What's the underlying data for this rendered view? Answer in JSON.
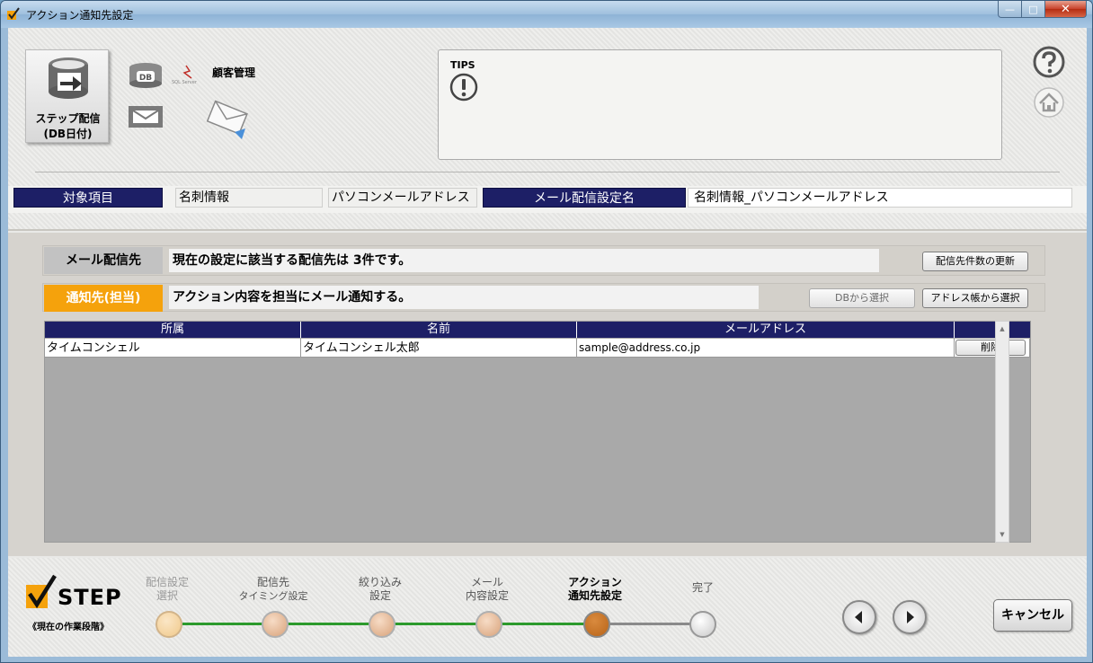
{
  "window": {
    "title": "アクション通知先設定",
    "buttons": {
      "minimize": "—",
      "maximize": "□",
      "close": "✕"
    }
  },
  "header": {
    "step_tile_line1": "ステップ配信",
    "step_tile_line2": "(DB日付)",
    "db_label": "DB",
    "sql_label": "SQL Server",
    "customer_mgmt": "顧客管理",
    "tips_label": "TIPS",
    "tips_icon": "exclamation-icon",
    "help_icon": "question-icon",
    "home_icon": "home-icon"
  },
  "info_bar": {
    "target_item_label": "対象項目",
    "target_item_value1": "名刺情報",
    "target_item_value2": "パソコンメールアドレス",
    "delivery_setting_label": "メール配信設定名",
    "delivery_setting_value": "名刺情報_パソコンメールアドレス"
  },
  "mail_delivery": {
    "label": "メール配信先",
    "message": "現在の設定に該当する配信先は 3件です。",
    "refresh_button": "配信先件数の更新"
  },
  "notify": {
    "label": "通知先(担当)",
    "message": "アクション内容を担当にメール通知する。",
    "db_select_button": "DBから選択",
    "address_book_button": "アドレス帳から選択"
  },
  "grid": {
    "columns": [
      "所属",
      "名前",
      "メールアドレス",
      ""
    ],
    "rows": [
      {
        "affiliation": "タイムコンシェル",
        "name": "タイムコンシェル太郎",
        "email": "sample@address.co.jp",
        "delete": "削除"
      }
    ]
  },
  "step_bar": {
    "word": "STEP",
    "subtitle": "《現在の作業段階》",
    "steps": [
      {
        "line1": "配信設定",
        "line2": "選択",
        "state": "done-dim"
      },
      {
        "line1": "配信先",
        "line2": "タイミング設定",
        "state": "done"
      },
      {
        "line1": "絞り込み",
        "line2": "設定",
        "state": "done"
      },
      {
        "line1": "メール",
        "line2": "内容設定",
        "state": "done"
      },
      {
        "line1": "アクション",
        "line2": "通知先設定",
        "state": "current"
      },
      {
        "line1": "完了",
        "line2": "",
        "state": "todo"
      }
    ],
    "prev_icon": "arrow-left-icon",
    "next_icon": "arrow-right-icon",
    "cancel_button": "キャンセル"
  },
  "colors": {
    "navy": "#1d1f66",
    "orange": "#f5a20c",
    "progress_green": "#2c9a2c",
    "current_step": "#b86418"
  }
}
